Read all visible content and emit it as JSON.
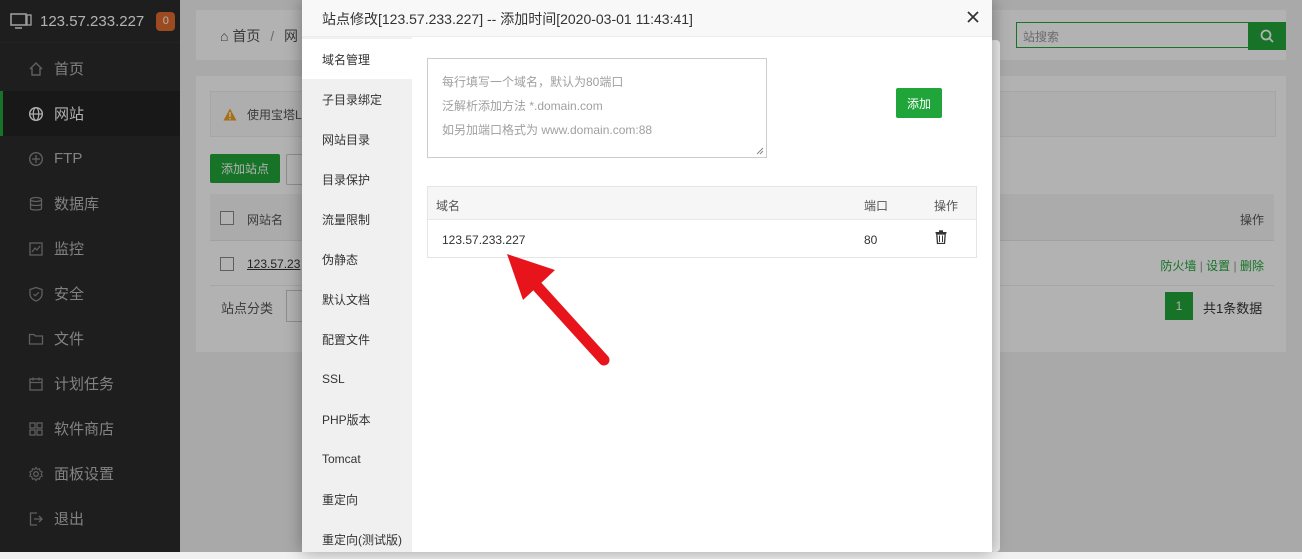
{
  "sidebar": {
    "server_ip": "123.57.233.227",
    "badge": "0",
    "items": [
      {
        "label": "首页",
        "icon": "home-icon"
      },
      {
        "label": "网站",
        "icon": "globe-icon"
      },
      {
        "label": "FTP",
        "icon": "ftp-icon"
      },
      {
        "label": "数据库",
        "icon": "database-icon"
      },
      {
        "label": "监控",
        "icon": "monitor-icon"
      },
      {
        "label": "安全",
        "icon": "shield-icon"
      },
      {
        "label": "文件",
        "icon": "folder-icon"
      },
      {
        "label": "计划任务",
        "icon": "calendar-icon"
      },
      {
        "label": "软件商店",
        "icon": "grid-icon"
      },
      {
        "label": "面板设置",
        "icon": "gear-icon"
      },
      {
        "label": "退出",
        "icon": "exit-icon"
      }
    ]
  },
  "main": {
    "breadcrumb_home": "首页",
    "breadcrumb_sep": "/",
    "breadcrumb_current": "网",
    "search_placeholder": "站搜索",
    "warning_text": "使用宝塔L",
    "add_site_label": "添加站点",
    "table_header_name": "网站名",
    "table_header_op": "操作",
    "row_name": "123.57.23",
    "row_actions": [
      "防火墙",
      "设置",
      "删除"
    ],
    "row_sep": "|",
    "category_label": "站点分类",
    "page_current": "1",
    "page_total": "共1条数据"
  },
  "modal": {
    "title": "站点修改[123.57.233.227] -- 添加时间[2020-03-01 11:43:41]",
    "tabs": [
      "域名管理",
      "子目录绑定",
      "网站目录",
      "目录保护",
      "流量限制",
      "伪静态",
      "默认文档",
      "配置文件",
      "SSL",
      "PHP版本",
      "Tomcat",
      "重定向",
      "重定向(测试版)"
    ],
    "placeholder_lines": [
      "每行填写一个域名，默认为80端口",
      "泛解析添加方法 *.domain.com",
      "如另加端口格式为 www.domain.com:88"
    ],
    "add_label": "添加",
    "col_domain": "域名",
    "col_port": "端口",
    "col_op": "操作",
    "domain_value": "123.57.233.227",
    "port_value": "80"
  },
  "colors": {
    "accent": "#20a53a",
    "badge": "#e06c2e",
    "arrow": "#e8141b"
  }
}
